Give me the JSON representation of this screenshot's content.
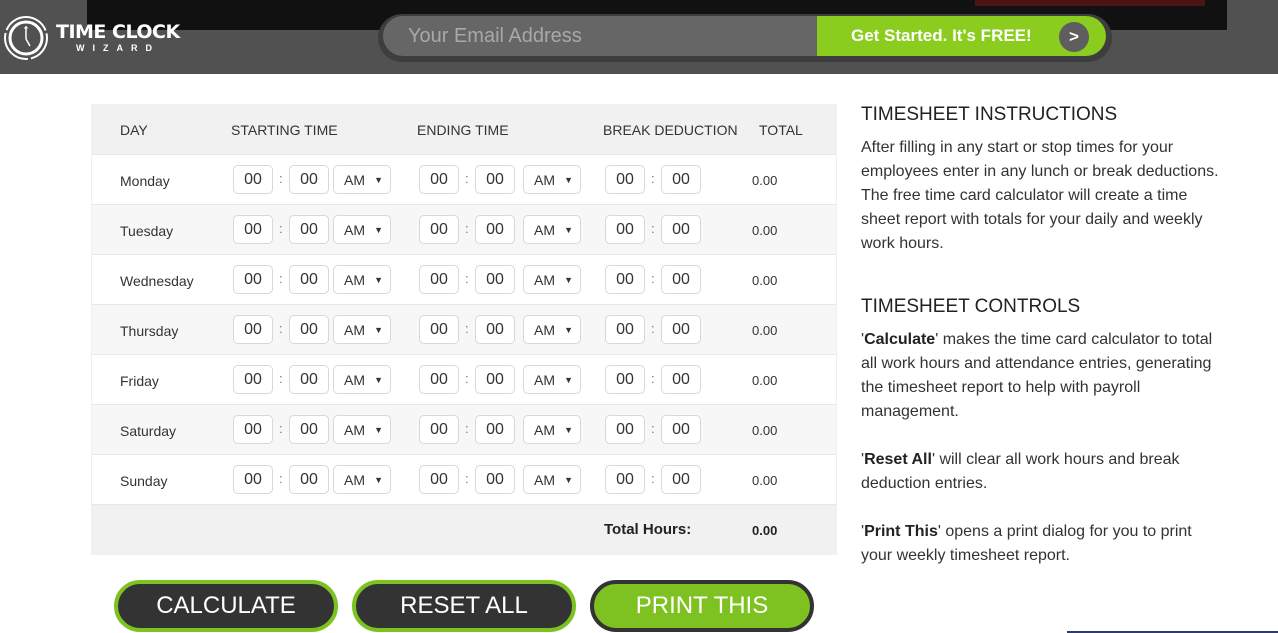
{
  "header": {
    "logo_title": "TIME CLOCK",
    "logo_subtitle": "WIZARD",
    "email_placeholder": "Your Email Address",
    "email_value": "",
    "cta_label": "Get Started. It's FREE!",
    "cta_arrow": ">"
  },
  "table": {
    "columns": [
      "DAY",
      "STARTING TIME",
      "ENDING TIME",
      "BREAK DEDUCTION",
      "TOTAL"
    ],
    "separator": ":",
    "dropdown_arrow": "▼",
    "rows": [
      {
        "day": "Monday",
        "start_h": "00",
        "start_m": "00",
        "start_ampm": "AM",
        "end_h": "00",
        "end_m": "00",
        "end_ampm": "AM",
        "break_h": "00",
        "break_m": "00",
        "total": "0.00"
      },
      {
        "day": "Tuesday",
        "start_h": "00",
        "start_m": "00",
        "start_ampm": "AM",
        "end_h": "00",
        "end_m": "00",
        "end_ampm": "AM",
        "break_h": "00",
        "break_m": "00",
        "total": "0.00"
      },
      {
        "day": "Wednesday",
        "start_h": "00",
        "start_m": "00",
        "start_ampm": "AM",
        "end_h": "00",
        "end_m": "00",
        "end_ampm": "AM",
        "break_h": "00",
        "break_m": "00",
        "total": "0.00"
      },
      {
        "day": "Thursday",
        "start_h": "00",
        "start_m": "00",
        "start_ampm": "AM",
        "end_h": "00",
        "end_m": "00",
        "end_ampm": "AM",
        "break_h": "00",
        "break_m": "00",
        "total": "0.00"
      },
      {
        "day": "Friday",
        "start_h": "00",
        "start_m": "00",
        "start_ampm": "AM",
        "end_h": "00",
        "end_m": "00",
        "end_ampm": "AM",
        "break_h": "00",
        "break_m": "00",
        "total": "0.00"
      },
      {
        "day": "Saturday",
        "start_h": "00",
        "start_m": "00",
        "start_ampm": "AM",
        "end_h": "00",
        "end_m": "00",
        "end_ampm": "AM",
        "break_h": "00",
        "break_m": "00",
        "total": "0.00"
      },
      {
        "day": "Sunday",
        "start_h": "00",
        "start_m": "00",
        "start_ampm": "AM",
        "end_h": "00",
        "end_m": "00",
        "end_ampm": "AM",
        "break_h": "00",
        "break_m": "00",
        "total": "0.00"
      }
    ],
    "total_label": "Total Hours:",
    "total_value": "0.00"
  },
  "buttons": {
    "calculate": "CALCULATE",
    "reset": "RESET ALL",
    "print": "PRINT THIS"
  },
  "instructions": {
    "title": "TIMESHEET INSTRUCTIONS",
    "body": "After filling in any start or stop times for your employees enter in any lunch or break deductions. The free time card calculator will create a time sheet report with totals for your daily and weekly work hours.",
    "controls_title": "TIMESHEET CONTROLS",
    "controls": [
      {
        "name": "Calculate",
        "text": " makes the time card calculator to total all work hours and attendance entries, generating the timesheet report to help with payroll management."
      },
      {
        "name": "Reset All",
        "text": " will clear all work hours and break deduction entries."
      },
      {
        "name": "Print This",
        "text": " opens a print dialog for you to print your weekly timesheet report."
      }
    ]
  },
  "colors": {
    "accent_green": "#8acd1e",
    "button_dark": "#333333",
    "header_bg": "#515151"
  }
}
